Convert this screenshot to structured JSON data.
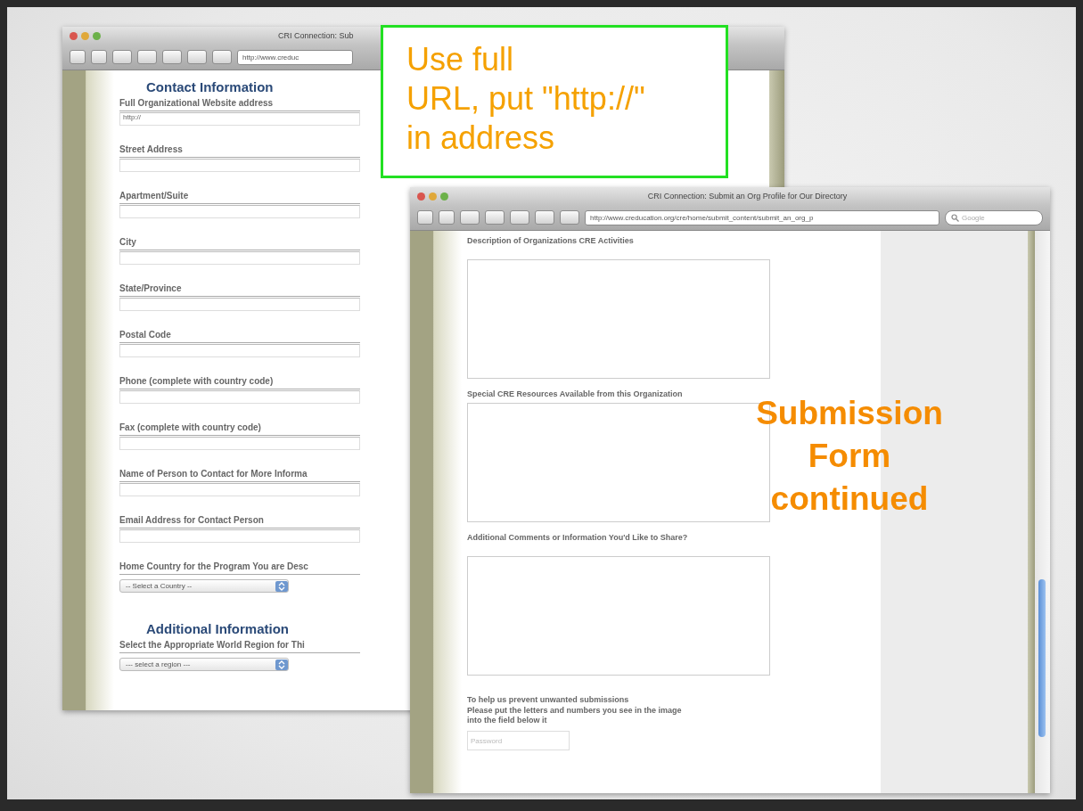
{
  "windows": [
    {
      "title": "CRI Connection: Sub",
      "url": "http://www.creduc",
      "sections": [
        {
          "heading": "Contact Information",
          "fields": [
            {
              "kind": "text",
              "label": "Full Organizational Website address",
              "value": "http://"
            },
            {
              "kind": "text",
              "label": "Street Address"
            },
            {
              "kind": "text",
              "label": "Apartment/Suite"
            },
            {
              "kind": "text",
              "label": "City"
            },
            {
              "kind": "text",
              "label": "State/Province"
            },
            {
              "kind": "text",
              "label": "Postal Code"
            },
            {
              "kind": "text",
              "label": "Phone (complete with country code)"
            },
            {
              "kind": "text",
              "label": "Fax (complete with country code)"
            },
            {
              "kind": "text",
              "label": "Name of Person to Contact for More Informa"
            },
            {
              "kind": "text",
              "label": "Email Address for Contact Person"
            },
            {
              "kind": "select",
              "label": "Home Country for the Program You are Desc",
              "value": "-- Select a Country --"
            }
          ]
        },
        {
          "heading": "Additional Information",
          "fields": [
            {
              "kind": "select",
              "label": "Select the Appropriate World Region for Thi",
              "value": "--- select a region ---"
            }
          ]
        }
      ]
    },
    {
      "title": "CRI Connection: Submit an Org Profile for Our Directory",
      "url": "http://www.creducation.org/cre/home/submit_content/submit_an_org_p",
      "search": {
        "placeholder": "Google"
      },
      "sections": [
        {
          "fields": [
            {
              "kind": "textarea",
              "label": "Description of Organizations CRE Activities"
            },
            {
              "kind": "textarea",
              "label": "Special CRE Resources Available from this Organization"
            },
            {
              "kind": "textarea",
              "label": "Additional Comments or Information You'd Like to Share?"
            },
            {
              "kind": "note",
              "lines": [
                "To help us prevent unwanted submissions",
                "Please put the letters and numbers you see in the image",
                "into the field below it"
              ]
            },
            {
              "kind": "captcha",
              "placeholder": "Password"
            }
          ]
        }
      ]
    }
  ],
  "callouts": [
    {
      "kind": "boxed",
      "lines": [
        "Use full",
        "URL, put \"http://\"",
        "in address"
      ]
    },
    {
      "kind": "plain",
      "lines": [
        "Submission",
        "Form",
        "continued"
      ]
    }
  ]
}
